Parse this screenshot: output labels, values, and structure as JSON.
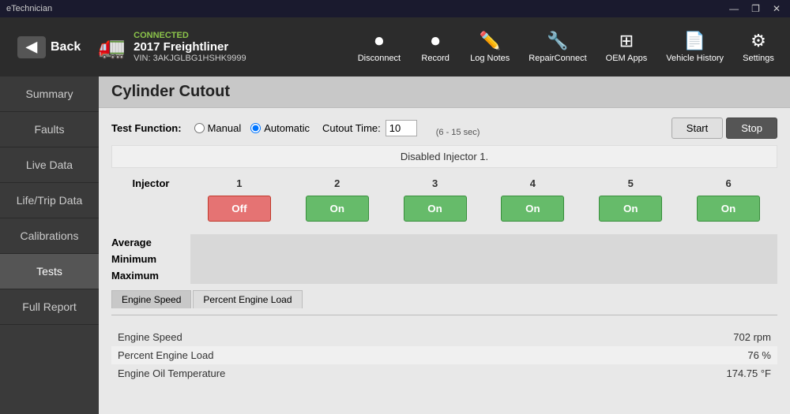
{
  "titlebar": {
    "app_name": "eTechnician",
    "btn_minimize": "—",
    "btn_restore": "❐",
    "btn_close": "✕"
  },
  "header": {
    "back_label": "Back",
    "connection_status": "CONNECTED",
    "vehicle_year_make": "2017 Freightliner",
    "vehicle_vin_label": "VIN: 3AKJGLBG1HSHK9999",
    "tools": [
      {
        "id": "disconnect",
        "label": "Disconnect",
        "icon": "⏺"
      },
      {
        "id": "record",
        "label": "Record",
        "icon": "⏺"
      },
      {
        "id": "log-notes",
        "label": "Log Notes",
        "icon": "✏️"
      },
      {
        "id": "repair-connect",
        "label": "RepairConnect",
        "icon": "🔧"
      },
      {
        "id": "oem-apps",
        "label": "OEM Apps",
        "icon": "⊞"
      },
      {
        "id": "vehicle-history",
        "label": "Vehicle History",
        "icon": "📄"
      },
      {
        "id": "settings",
        "label": "Settings",
        "icon": "⚙"
      }
    ]
  },
  "sidebar": {
    "items": [
      {
        "id": "summary",
        "label": "Summary",
        "active": false
      },
      {
        "id": "faults",
        "label": "Faults",
        "active": false
      },
      {
        "id": "live-data",
        "label": "Live Data",
        "active": false
      },
      {
        "id": "life-trip-data",
        "label": "Life/Trip Data",
        "active": false
      },
      {
        "id": "calibrations",
        "label": "Calibrations",
        "active": false
      },
      {
        "id": "tests",
        "label": "Tests",
        "active": true
      },
      {
        "id": "full-report",
        "label": "Full Report",
        "active": false
      }
    ]
  },
  "page": {
    "title": "Cylinder Cutout",
    "test_function_label": "Test Function:",
    "manual_label": "Manual",
    "automatic_label": "Automatic",
    "cutout_time_label": "Cutout Time:",
    "cutout_time_value": "10",
    "cutout_time_range": "(6 - 15 sec)",
    "start_label": "Start",
    "stop_label": "Stop",
    "status_message": "Disabled Injector 1.",
    "injector_header": "Injector",
    "injectors": [
      {
        "number": "1",
        "state": "Off",
        "active": false
      },
      {
        "number": "2",
        "state": "On",
        "active": true
      },
      {
        "number": "3",
        "state": "On",
        "active": true
      },
      {
        "number": "4",
        "state": "On",
        "active": true
      },
      {
        "number": "5",
        "state": "On",
        "active": true
      },
      {
        "number": "6",
        "state": "On",
        "active": true
      }
    ],
    "stats": [
      {
        "label": "Average",
        "value": ""
      },
      {
        "label": "Minimum",
        "value": ""
      },
      {
        "label": "Maximum",
        "value": ""
      }
    ],
    "tabs": [
      {
        "id": "engine-speed",
        "label": "Engine Speed",
        "active": true
      },
      {
        "id": "percent-engine-load",
        "label": "Percent Engine Load",
        "active": false
      }
    ],
    "data_rows": [
      {
        "label": "Engine Speed",
        "value": "702 rpm"
      },
      {
        "label": "Percent Engine Load",
        "value": "76 %"
      },
      {
        "label": "Engine Oil Temperature",
        "value": "174.75 °F"
      }
    ]
  }
}
